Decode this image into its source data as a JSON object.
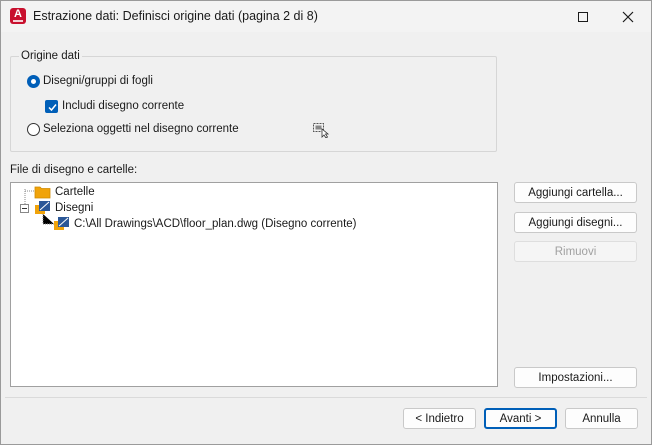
{
  "window": {
    "title": "Estrazione dati: Definisci origine dati (pagina 2 di 8)",
    "app_icon_letter": "A"
  },
  "source_group": {
    "label": "Origine dati",
    "radio_drawings": {
      "label": "Disegni/gruppi di fogli",
      "checked": true
    },
    "checkbox_current": {
      "label": "Includi disegno corrente",
      "checked": true
    },
    "radio_select": {
      "label": "Seleziona oggetti nel disegno corrente",
      "checked": false
    },
    "select_icon": "select-objects-icon"
  },
  "files_section": {
    "label": "File di disegno e cartelle:",
    "tree": {
      "folders_label": "Cartelle",
      "drawings_label": "Disegni",
      "drawing_item": "C:\\All Drawings\\ACD\\floor_plan.dwg (Disegno corrente)"
    }
  },
  "side_buttons": {
    "add_folder": "Aggiungi cartella...",
    "add_drawings": "Aggiungi disegni...",
    "remove": "Rimuovi",
    "settings": "Impostazioni..."
  },
  "footer": {
    "back": "< Indietro",
    "next": "Avanti >",
    "cancel": "Annulla"
  },
  "colors": {
    "accent": "#005fb8",
    "app_icon": "#c8102e",
    "folder": "#f0a30a"
  }
}
